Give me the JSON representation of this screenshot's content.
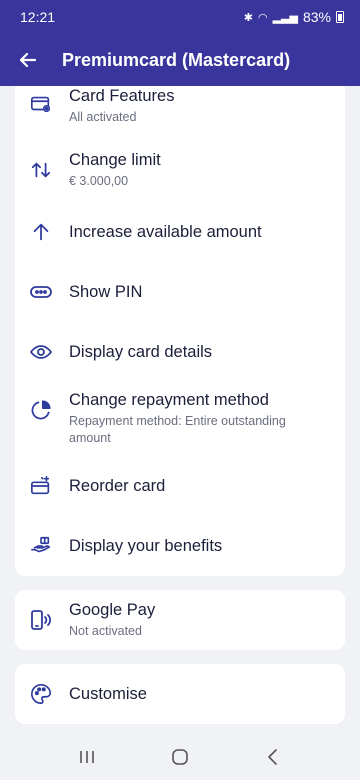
{
  "status": {
    "time": "12:21",
    "battery": "83%"
  },
  "header": {
    "title": "Premiumcard (Mastercard)"
  },
  "menu": [
    {
      "key": "card-features",
      "icon": "card-settings-icon",
      "title": "Card Features",
      "subtitle": "All activated"
    },
    {
      "key": "change-limit",
      "icon": "arrows-up-down-icon",
      "title": "Change limit",
      "subtitle": "€ 3.000,00"
    },
    {
      "key": "increase-amount",
      "icon": "arrow-up-icon",
      "title": "Increase available amount",
      "subtitle": ""
    },
    {
      "key": "show-pin",
      "icon": "pin-dots-icon",
      "title": "Show PIN",
      "subtitle": ""
    },
    {
      "key": "display-details",
      "icon": "eye-icon",
      "title": "Display card details",
      "subtitle": ""
    },
    {
      "key": "repayment",
      "icon": "pie-chart-icon",
      "title": "Change repayment method",
      "subtitle": "Repayment method: Entire outstanding amount"
    },
    {
      "key": "reorder",
      "icon": "reorder-card-icon",
      "title": "Reorder card",
      "subtitle": ""
    },
    {
      "key": "benefits",
      "icon": "hand-gift-icon",
      "title": "Display your benefits",
      "subtitle": ""
    }
  ],
  "google_pay": {
    "icon": "phone-contactless-icon",
    "title": "Google Pay",
    "subtitle": "Not activated"
  },
  "customise": {
    "icon": "palette-icon",
    "title": "Customise"
  },
  "colors": {
    "brand": "#3a359c",
    "icon": "#2f3a9e",
    "text": "#1b1f3a"
  }
}
